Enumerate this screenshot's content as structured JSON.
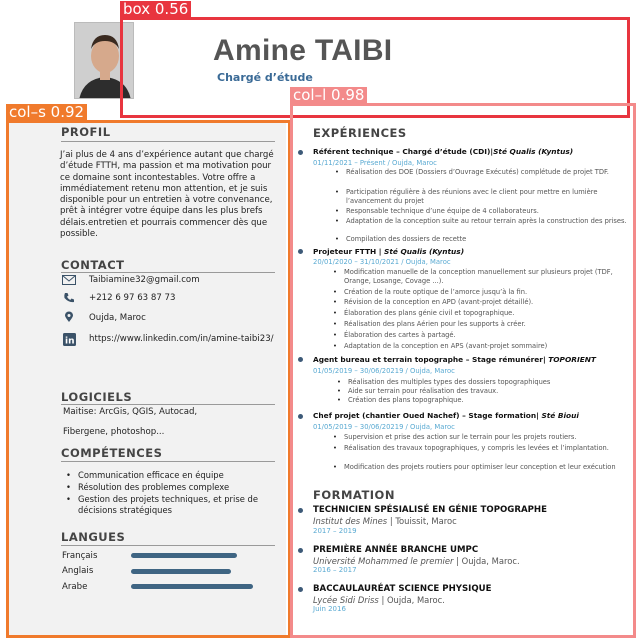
{
  "header": {
    "name": "Amine TAIBI",
    "role": "Chargé d’étude"
  },
  "annotations": {
    "box": "box 0.56",
    "col_s": "col–s 0.92",
    "col_l": "col–l 0.98"
  },
  "profil": {
    "title": "PROFIL",
    "text": "J’ai plus de 4 ans d’expérience autant que chargé d’étude FTTH, ma passion et ma motivation pour ce domaine sont incontestables. Votre offre a immédiatement retenu mon attention, et je suis disponible pour un entretien à votre convenance, prêt à intégrer votre équipe dans les plus brefs délais.entretien et pourrais commencer dès que possible."
  },
  "contact": {
    "title": "CONTACT",
    "email": "Taibiamine32@gmail.com",
    "phone": "+212 6 97 63 87 73",
    "location": "Oujda, Maroc",
    "linkedin": "https://www.linkedin.com/in/amine-taibi23/",
    "icons": [
      "envelope-icon",
      "phone-icon",
      "location-pin-icon",
      "linkedin-icon"
    ]
  },
  "logiciels": {
    "title": "LOGICIELS",
    "line1": "Maitise: ArcGis, QGIS, Autocad,",
    "line2": "Fibergene, photoshop..."
  },
  "competences": {
    "title": "COMPÉTENCES",
    "items": [
      "Communication efficace en équipe",
      "Résolution des problemes complexe",
      "Gestion des projets techniques, et prise de décisions stratégiques"
    ]
  },
  "langues": {
    "title": "LANGUES",
    "items": [
      {
        "name": "Français"
      },
      {
        "name": "Anglais"
      },
      {
        "name": "Arabe"
      }
    ]
  },
  "experiences": {
    "title": "EXPÉRIENCES",
    "jobs": [
      {
        "title": "Référent technique – Chargé d’étude (CDI)|",
        "company": "Sté Qualis (Kyntus)",
        "date": "01/11/2021 – Présent / Oujda, Maroc",
        "bullets": [
          "Réalisation des DOE (Dossiers d’Ouvrage Exécutés) complétude de projet TDF.",
          "Participation régulière à des réunions avec le client pour mettre en lumière l’avancement du projet",
          "Responsable technique d’une équipe de 4 collaborateurs.",
          "Adaptation de la conception suite au retour terrain après la construction des prises.",
          "Compilation des dossiers de recette"
        ]
      },
      {
        "title": "Projeteur FTTH |",
        "company": "Sté Qualis (Kyntus)",
        "date": "20/01/2020 – 31/10/2021 / Oujda, Maroc",
        "bullets": [
          "Modification manuelle de la conception manuellement sur plusieurs projet (TDF, Orange, Losange, Covage ...).",
          "Création de la route optique de l’amorce jusqu’à la fin.",
          "Révision de la conception en APD (avant-projet détaillé).",
          "Élaboration des plans génie civil et topographique.",
          "Réalisation des plans Aérien pour les supports à créer.",
          "Élaboration des cartes à partagé.",
          "Adaptation de la conception en APS (avant-projet sommaire)"
        ]
      },
      {
        "title": "Agent bureau et terrain topographe – Stage rémunérer|",
        "company": "TOPORIENT",
        "date": "01/05/2019 – 30/06/20219 / Oujda, Maroc",
        "bullets": [
          "Réalisation des multiples types des dossiers topographiques",
          "Aide sur terrain pour réalisation des travaux.",
          "Création des plans topographique."
        ]
      },
      {
        "title": "Chef projet (chantier Oued Nachef) – Stage formation|",
        "company": "Sté Bioui",
        "date": "01/05/2019 – 30/06/20219 / Oujda, Maroc",
        "bullets": [
          "Supervision et prise des action sur le terrain pour les projets routiers.",
          "Réalisation des travaux topographiques, y compris les levées et l’implantation.",
          "Modification des projets routiers pour optimiser leur conception et leur exécution"
        ]
      }
    ]
  },
  "formation": {
    "title": "FORMATION",
    "items": [
      {
        "title": "TECHNICIEN SPÉSIALISÉ EN GÉNIE TOPOGRAPHE",
        "school": "Institut des Mines",
        "place": " | Touissit, Maroc",
        "date": "2017 – 2019"
      },
      {
        "title": "PREMIÈRE ANNÉE BRANCHE UMPC",
        "school": "Université Mohammed le premier",
        "place": " | Oujda, Maroc.",
        "date": "2016 – 2017"
      },
      {
        "title": "BACCAULAURÉAT SCIENCE PHYSIQUE",
        "school": "Lycée Sidi Driss",
        "place": " | Oujda, Maroc.",
        "date": "Juin 2016"
      }
    ]
  },
  "colors": {
    "accent": "#3a6a96",
    "date": "#5aaad2",
    "bar": "#3f6583",
    "box_red": "#e8353f",
    "col_s_orange": "#f07a2c",
    "col_l_pink": "#f38a8a"
  }
}
